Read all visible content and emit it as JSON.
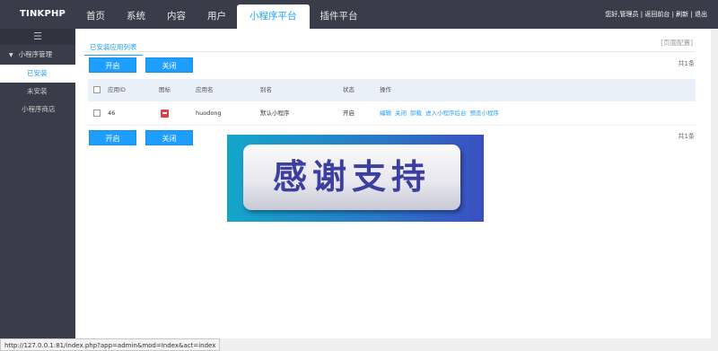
{
  "header": {
    "logo": "TINKPHP",
    "nav": [
      "首页",
      "系统",
      "内容",
      "用户",
      "小程序平台",
      "插件平台"
    ],
    "active_nav": "小程序平台",
    "greeting": "您好,管理员",
    "links": [
      "返回前台",
      "刷新",
      "退出"
    ]
  },
  "sidebar": {
    "toggle_icon": "☰",
    "group": "小程序管理",
    "items": [
      "已安装",
      "未安装",
      "小程序商店"
    ]
  },
  "main": {
    "tab": "已安装应用列表",
    "page_config": "[页面配置]",
    "btn_enable": "开启",
    "btn_disable": "关闭",
    "count": "共1条",
    "table": {
      "headers": [
        "应用ID",
        "图标",
        "应用名",
        "别名",
        "状态",
        "操作"
      ],
      "rows": [
        {
          "id": "46",
          "name": "huodong",
          "alias": "默认小程序",
          "status": "开启",
          "ops": [
            "编辑",
            "关闭",
            "卸载",
            "进入小程序后台",
            "预览小程序"
          ]
        }
      ]
    }
  },
  "banner": {
    "text": "感谢支持"
  },
  "statusbar": {
    "url": "http://127.0.0.1:81/index.php?app=admin&mod=Index&act=index"
  },
  "colors": {
    "accent": "#1e9fff",
    "topbar": "#393d49"
  }
}
